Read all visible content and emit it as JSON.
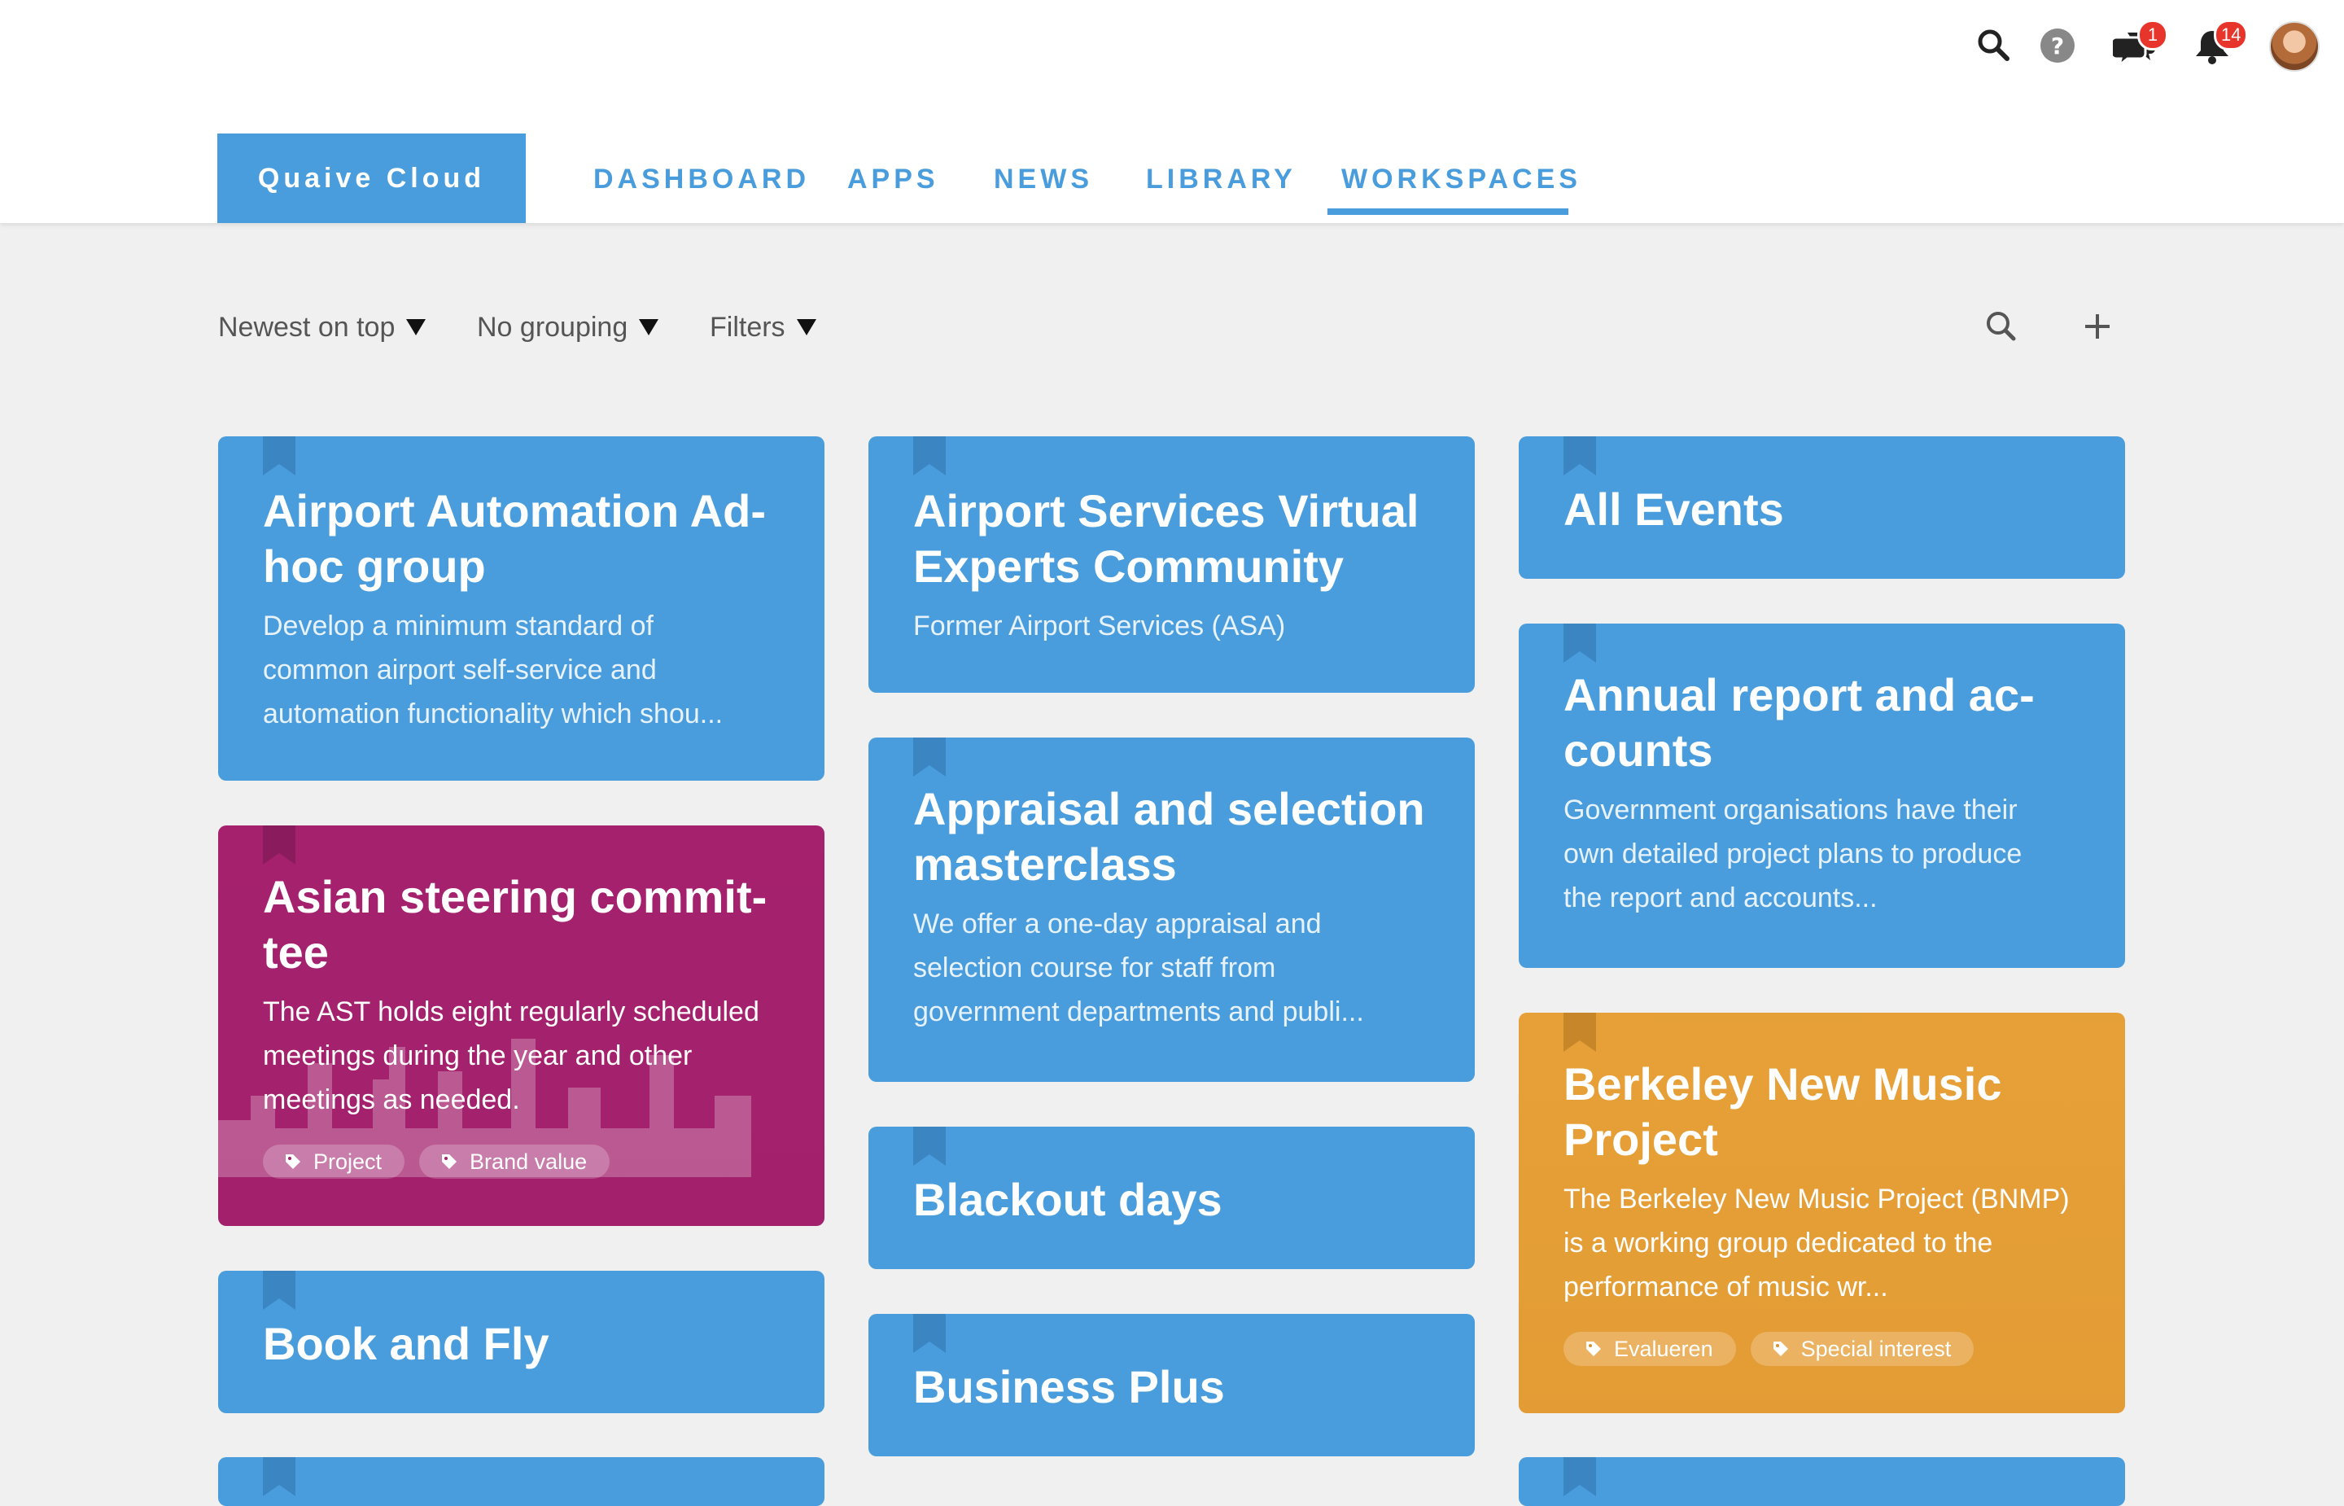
{
  "header": {
    "brand": "Quaive Cloud",
    "nav": [
      {
        "label": "DASHBOARD"
      },
      {
        "label": "APPS"
      },
      {
        "label": "NEWS"
      },
      {
        "label": "LIBRARY"
      },
      {
        "label": "WORKSPACES",
        "active": true
      }
    ],
    "icons": {
      "search": "search-icon",
      "help": "help-icon",
      "messages": "chat-icon",
      "notifications": "bell-icon",
      "avatar": "user-avatar"
    },
    "badges": {
      "messages": "1",
      "notifications": "14"
    }
  },
  "toolbar": {
    "sort": "Newest on top",
    "grouping": "No grouping",
    "filters": "Filters"
  },
  "colors": {
    "accent": "#4a9ddd",
    "magenta": "#a5216e",
    "orange": "#e7a037",
    "badge": "#e8352b",
    "background": "#f0f0f0"
  },
  "cards": [
    {
      "title_line1": "Airport Automation Ad-",
      "title_line2": "hoc group",
      "desc_line1": "Develop a minimum standard of",
      "desc_line2": "common airport self-service and",
      "desc_line3": "automation functionality which shou..."
    },
    {
      "title_line1": "Asian steering commit-",
      "title_line2": "tee",
      "desc_line1": "The AST holds eight regularly scheduled",
      "desc_line2": "meetings during the year and other",
      "desc_line3": "meetings as needed.",
      "tags": [
        "Project",
        "Brand value"
      ]
    },
    {
      "title_line1": "Book and Fly"
    },
    {
      "title_line1": "Airport Services Virtual",
      "title_line2": "Experts Community",
      "desc_line1": "Former Airport Services (ASA)"
    },
    {
      "title_line1": "Appraisal and selection",
      "title_line2": "masterclass",
      "desc_line1": "We offer a one-day appraisal and",
      "desc_line2": "selection course for staff from",
      "desc_line3": "government departments and publi..."
    },
    {
      "title_line1": "Blackout days"
    },
    {
      "title_line1": "Business Plus"
    },
    {
      "title_line1": "All Events"
    },
    {
      "title_line1": "Annual report and ac-",
      "title_line2": "counts",
      "desc_line1": "Government organisations have their",
      "desc_line2": "own detailed project plans to produce",
      "desc_line3": "the report and accounts..."
    },
    {
      "title_line1": "Berkeley New Music",
      "title_line2": "Project",
      "desc_line1": "The Berkeley New Music Project (BNMP)",
      "desc_line2": "is a working group dedicated to the",
      "desc_line3": "performance of music wr...",
      "tags": [
        "Evalueren",
        "Special interest"
      ]
    }
  ]
}
